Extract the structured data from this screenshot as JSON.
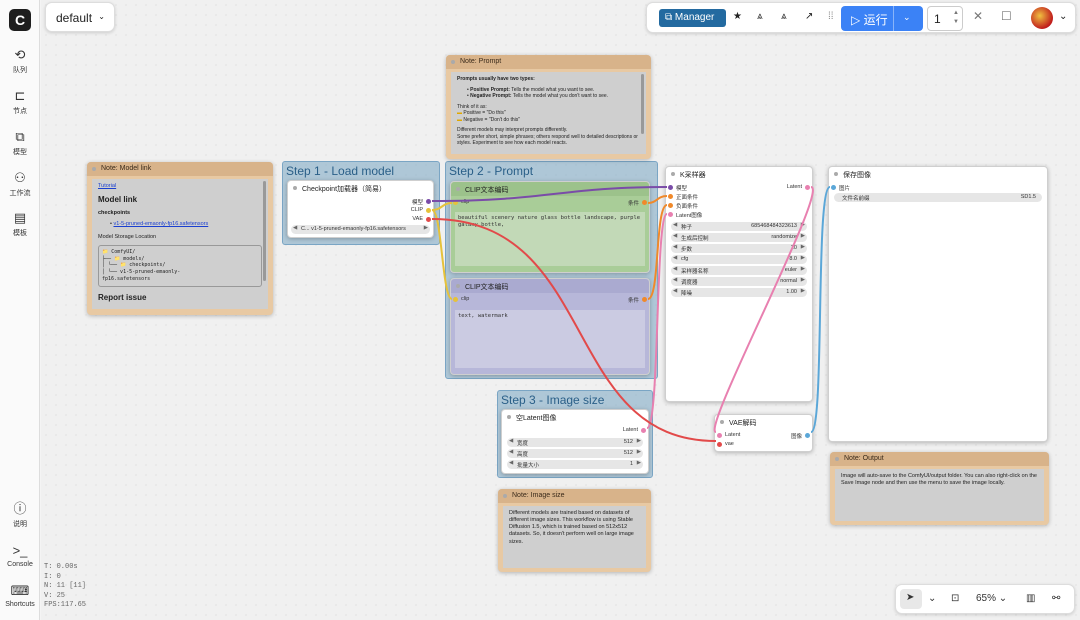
{
  "workflow_tab": "default",
  "topbar": {
    "manager": "Manager",
    "run": "运行",
    "queue_count": "1"
  },
  "sidebar": {
    "items": [
      {
        "label": "队列",
        "icon": "history-icon"
      },
      {
        "label": "节点",
        "icon": "node-icon"
      },
      {
        "label": "模型",
        "icon": "model-icon"
      },
      {
        "label": "工作流",
        "icon": "workflow-icon"
      },
      {
        "label": "模板",
        "icon": "template-icon"
      }
    ],
    "bottom": [
      {
        "label": "说明",
        "icon": "help-icon"
      },
      {
        "label": "Console",
        "icon": "console-icon"
      },
      {
        "label": "Shortcuts",
        "icon": "keyboard-icon"
      }
    ]
  },
  "groups": {
    "step1": "Step 1 - Load model",
    "step2": "Step 2 - Prompt",
    "step3": "Step 3 - Image size"
  },
  "notes": {
    "model_link": {
      "title": "Note: Model link",
      "tutorial": "Tutorial",
      "heading": "Model link",
      "sub": "checkpoints",
      "file": "v1-5-pruned-emaonly-fp16.safetensors",
      "storage": "Model Storage Location",
      "tree": [
        "📁 ComfyUI/",
        "├── 📁 models/",
        "│   └── 📁 checkpoints/",
        "│       └── v1-5-pruned-emaonly-",
        "fp16.safetensors"
      ],
      "report": "Report issue"
    },
    "prompt": {
      "title": "Note: Prompt",
      "lead": "Prompts usually have two types:",
      "pos_label": "Positive Prompt:",
      "pos_text": "Tells the model what you want to see.",
      "neg_label": "Negative Prompt:",
      "neg_text": "Tells the model what you don't want to see.",
      "think": "Think of it as:",
      "positive": "Positive = \"Do this\"",
      "negative": "Negative = \"Don't do this\"",
      "diff": "Different models may interpret prompts differently.",
      "some": "Some prefer short, simple phrases; others respond well to detailed descriptions or styles. Experiment to see how each model reacts."
    },
    "image_size": {
      "title": "Note: Image size",
      "text": "Different models are trained based on datasets of different image sizes. This workflow is using Stable Diffusion 1.5, which is trained based on 512x512 datasets. So, it doesn't perform well on large image sizes."
    },
    "output": {
      "title": "Note: Output",
      "text": "Image will auto-save to the ComfyUI/output folder. You can also right-click on the Save Image node and then use the menu to save the image locally."
    }
  },
  "nodes": {
    "checkpoint": {
      "title": "Checkpoint加载器（简易）",
      "out_model": "模型",
      "out_clip": "CLIP",
      "out_vae": "VAE",
      "ckpt": "C... v1-5-pruned-emaonly-fp16.safetensors"
    },
    "clip_pos": {
      "title": "CLIP文本编码",
      "in": "clip",
      "out": "条件",
      "text": "beautiful scenery nature glass bottle landscape, purple galaxy bottle,"
    },
    "clip_neg": {
      "title": "CLIP文本编码",
      "in": "clip",
      "out": "条件",
      "text": "text, watermark"
    },
    "ksampler": {
      "title": "K采样器",
      "in_model": "模型",
      "in_pos": "正面条件",
      "in_neg": "负面条件",
      "in_latent": "Latent图像",
      "out": "Latent",
      "widgets": [
        {
          "label": "种子",
          "value": "685468484323613"
        },
        {
          "label": "生成后控制",
          "value": "randomize"
        },
        {
          "label": "步数",
          "value": "20"
        },
        {
          "label": "cfg",
          "value": "8.0"
        },
        {
          "label": "采样器名称",
          "value": "euler"
        },
        {
          "label": "调度器",
          "value": "normal"
        },
        {
          "label": "降噪",
          "value": "1.00"
        }
      ]
    },
    "latent": {
      "title": "空Latent图像",
      "out": "Latent",
      "widgets": [
        {
          "label": "宽度",
          "value": "512"
        },
        {
          "label": "高度",
          "value": "512"
        },
        {
          "label": "批量大小",
          "value": "1"
        }
      ]
    },
    "vae": {
      "title": "VAE解码",
      "in_latent": "Latent",
      "in_vae": "vae",
      "out": "图像"
    },
    "save": {
      "title": "保存图像",
      "in": "图片",
      "prefix_label": "文件名前缀",
      "prefix_value": "SD1.5"
    }
  },
  "stats": [
    "T: 0.00s",
    "I: 0",
    "N: 11 [11]",
    "V: 25",
    "FPS:117.65"
  ],
  "zoom": "65%"
}
